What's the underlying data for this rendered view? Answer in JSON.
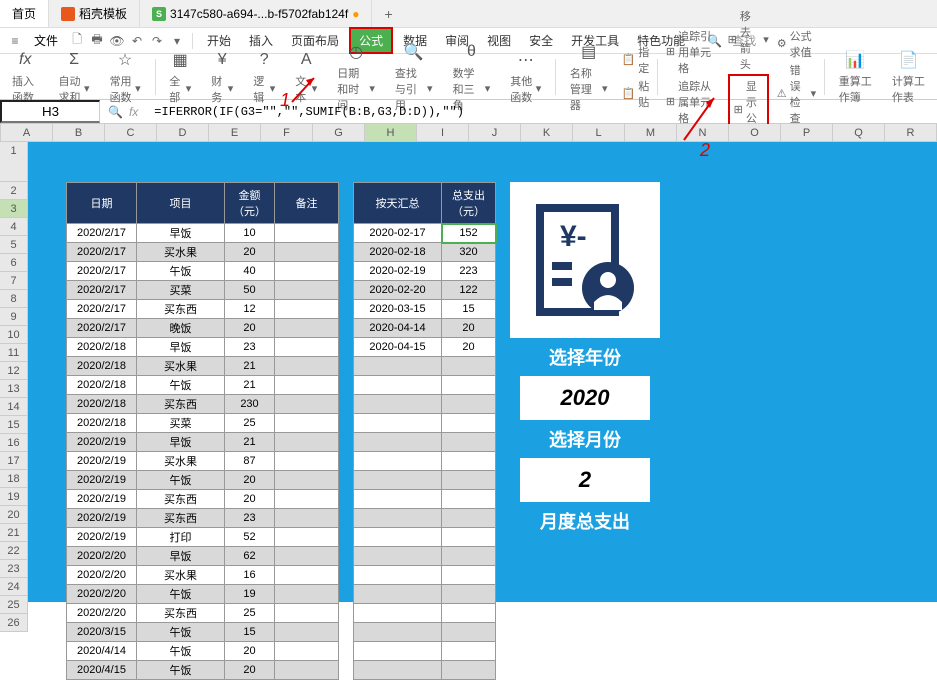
{
  "titlebar": {
    "home": "首页",
    "tab1": "稻壳模板",
    "tab2": "3147c580-a694-...b-f5702fab124f",
    "indicator": "●"
  },
  "menubar": {
    "file": "文件",
    "items": [
      "开始",
      "插入",
      "页面布局",
      "公式",
      "数据",
      "审阅",
      "视图",
      "安全",
      "开发工具",
      "特色功能"
    ],
    "search": "查找"
  },
  "toolbar": {
    "fx": "fx",
    "insert_fn": "插入函数",
    "autosum": "自动求和",
    "common": "常用函数",
    "all": "全部",
    "finance": "财务",
    "logic": "逻辑",
    "text": "文本",
    "datetime": "日期和时间",
    "lookup": "查找与引用",
    "math": "数学和三角",
    "other": "其他函数",
    "name_mgr": "名称管理器",
    "paste": "粘贴",
    "assign": "指定",
    "trace_ref": "追踪引用单元格",
    "trace_dep": "追踪从属单元格",
    "remove_arrow": "移去箭头",
    "show_formula": "显示公式",
    "calc_value": "公式求值",
    "error_check": "错误检查",
    "recalc": "重算工作簿",
    "calc_sheet": "计算工作表"
  },
  "formula": {
    "cell": "H3",
    "text": "=IFERROR(IF(G3=\"\",\"\",SUMIF(B:B,G3,D:D)),\"\")"
  },
  "columns": [
    "A",
    "B",
    "C",
    "D",
    "E",
    "F",
    "G",
    "H",
    "I",
    "J",
    "K",
    "L",
    "M",
    "N",
    "O",
    "P",
    "Q",
    "R"
  ],
  "table1": {
    "headers": [
      "日期",
      "项目",
      "金额（元）",
      "备注"
    ],
    "rows": [
      [
        "2020/2/17",
        "早饭",
        "10",
        ""
      ],
      [
        "2020/2/17",
        "买水果",
        "20",
        ""
      ],
      [
        "2020/2/17",
        "午饭",
        "40",
        ""
      ],
      [
        "2020/2/17",
        "买菜",
        "50",
        ""
      ],
      [
        "2020/2/17",
        "买东西",
        "12",
        ""
      ],
      [
        "2020/2/17",
        "晚饭",
        "20",
        ""
      ],
      [
        "2020/2/18",
        "早饭",
        "23",
        ""
      ],
      [
        "2020/2/18",
        "买水果",
        "21",
        ""
      ],
      [
        "2020/2/18",
        "午饭",
        "21",
        ""
      ],
      [
        "2020/2/18",
        "买东西",
        "230",
        ""
      ],
      [
        "2020/2/18",
        "买菜",
        "25",
        ""
      ],
      [
        "2020/2/19",
        "早饭",
        "21",
        ""
      ],
      [
        "2020/2/19",
        "买水果",
        "87",
        ""
      ],
      [
        "2020/2/19",
        "午饭",
        "20",
        ""
      ],
      [
        "2020/2/19",
        "买东西",
        "20",
        ""
      ],
      [
        "2020/2/19",
        "买东西",
        "23",
        ""
      ],
      [
        "2020/2/19",
        "打印",
        "52",
        ""
      ],
      [
        "2020/2/20",
        "早饭",
        "62",
        ""
      ],
      [
        "2020/2/20",
        "买水果",
        "16",
        ""
      ],
      [
        "2020/2/20",
        "午饭",
        "19",
        ""
      ],
      [
        "2020/2/20",
        "买东西",
        "25",
        ""
      ],
      [
        "2020/3/15",
        "午饭",
        "15",
        ""
      ],
      [
        "2020/4/14",
        "午饭",
        "20",
        ""
      ],
      [
        "2020/4/15",
        "午饭",
        "20",
        ""
      ]
    ]
  },
  "table2": {
    "headers": [
      "按天汇总",
      "总支出（元）"
    ],
    "rows": [
      [
        "2020-02-17",
        "152"
      ],
      [
        "2020-02-18",
        "320"
      ],
      [
        "2020-02-19",
        "223"
      ],
      [
        "2020-02-20",
        "122"
      ],
      [
        "2020-03-15",
        "15"
      ],
      [
        "2020-04-14",
        "20"
      ],
      [
        "2020-04-15",
        "20"
      ]
    ]
  },
  "panel": {
    "year_label": "选择年份",
    "year_value": "2020",
    "month_label": "选择月份",
    "month_value": "2",
    "total_label": "月度总支出"
  },
  "annotations": {
    "a1": "1",
    "a2": "2"
  }
}
